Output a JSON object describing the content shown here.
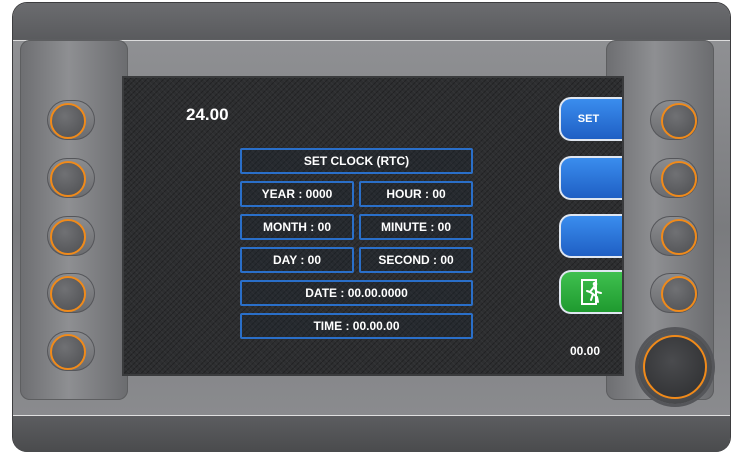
{
  "display": {
    "top_value": "24.00",
    "bottom_value": "00.00"
  },
  "clock_form": {
    "title": "SET CLOCK (RTC)",
    "year": "YEAR : 0000",
    "hour": "HOUR : 00",
    "month": "MONTH : 00",
    "minute": "MINUTE : 00",
    "day": "DAY : 00",
    "second": "SECOND : 00",
    "date": "DATE : 00.00.0000",
    "time": "TIME : 00.00.00"
  },
  "menu": {
    "set_label": "SET",
    "button_2_label": "",
    "button_3_label": "",
    "exit_icon": "exit-door-icon"
  },
  "colors": {
    "accent_orange": "#f08a1a",
    "field_border_blue": "#2a6fc9",
    "button_blue": "#2f7ae0",
    "button_green": "#2fb23f"
  }
}
